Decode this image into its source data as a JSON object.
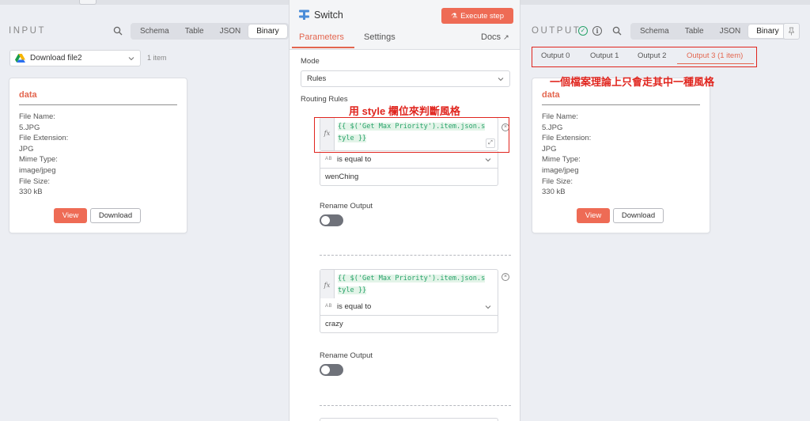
{
  "input_pane": {
    "title": "INPUT",
    "view_modes": [
      "Schema",
      "Table",
      "JSON",
      "Binary"
    ],
    "active_mode": "Binary",
    "source_select": "Download file2",
    "items_count": "1 item",
    "card": {
      "title": "data",
      "file_name_label": "File Name:",
      "file_name": "5.JPG",
      "file_ext_label": "File Extension:",
      "file_ext": "JPG",
      "mime_label": "Mime Type:",
      "mime": "image/jpeg",
      "size_label": "File Size:",
      "size": "330 kB",
      "view_label": "View",
      "download_label": "Download"
    }
  },
  "node": {
    "title": "Switch",
    "execute_label": "Execute step",
    "tabs": [
      "Parameters",
      "Settings"
    ],
    "docs_label": "Docs",
    "mode_label": "Mode",
    "mode_value": "Rules",
    "routing_label": "Routing Rules",
    "rules": [
      {
        "expr_line1": "{{ $('Get Max Priority').item.json.s",
        "expr_line2": "tyle }}",
        "operator": "is equal to",
        "value": "wenChing",
        "rename_label": "Rename Output"
      },
      {
        "expr_line1": "{{ $('Get Max Priority').item.json.s",
        "expr_line2": "tyle }}",
        "operator": "is equal to",
        "value": "crazy",
        "rename_label": "Rename Output"
      }
    ],
    "fx_label": "fx",
    "type_badge": "AB"
  },
  "output_pane": {
    "title": "OUTPUT",
    "view_modes": [
      "Schema",
      "Table",
      "JSON",
      "Binary"
    ],
    "active_mode": "Binary",
    "output_tabs": [
      "Output 0",
      "Output 1",
      "Output 2",
      "Output 3 (1 item)"
    ],
    "card": {
      "title": "data",
      "file_name_label": "File Name:",
      "file_name": "5.JPG",
      "file_ext_label": "File Extension:",
      "file_ext": "JPG",
      "mime_label": "Mime Type:",
      "mime": "image/jpeg",
      "size_label": "File Size:",
      "size": "330 kB",
      "view_label": "View",
      "download_label": "Download"
    }
  },
  "annotations": {
    "style_field": "用 style 欄位來判斷風格",
    "one_style": "一個檔案理論上只會走其中一種風格"
  },
  "colors": {
    "accent": "#ee6b55",
    "annotation": "#e0251e",
    "expression": "#26a269"
  }
}
